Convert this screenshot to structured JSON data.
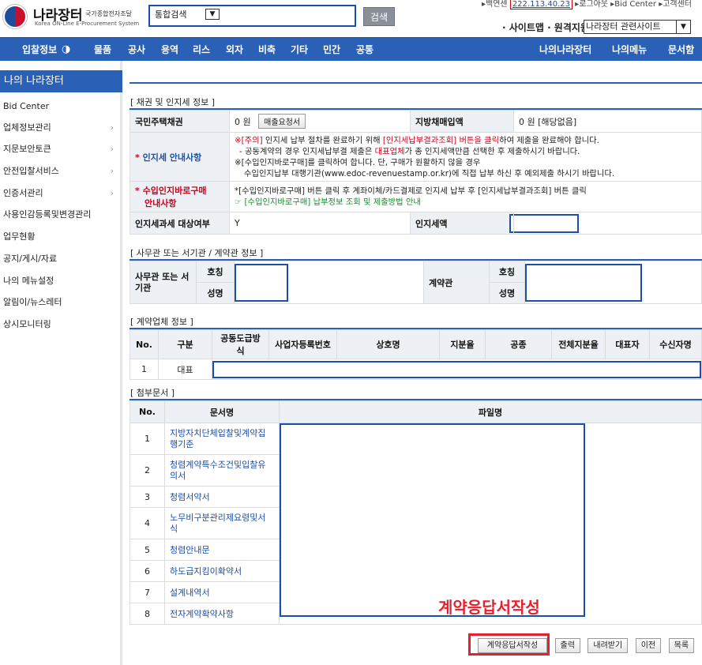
{
  "header": {
    "logo_title": "나라장터",
    "logo_ko": "국가종합전자조달",
    "logo_en": "Korea ON-Line E-Procurement System",
    "search_select": "통합검색",
    "search_button": "검색",
    "top_links_prefix": "▸백연센",
    "top_links_ip": "222.113.40.23",
    "top_links_rest": "▸로그아웃  ▸Bid Center  ▸고객센터",
    "sitemap": "· 사이트맵 · 원격지원",
    "related_select": "나라장터 관련사이트"
  },
  "nav": {
    "items": [
      "입찰정보",
      "물품",
      "공사",
      "용역",
      "리스",
      "외자",
      "비축",
      "기타",
      "민간",
      "공통"
    ],
    "right": [
      "나의나라장터",
      "나의메뉴",
      "문서함"
    ]
  },
  "sidebar": {
    "title": "나의 나라장터",
    "items": [
      "Bid Center",
      "업체정보관리",
      "지문보안토큰",
      "안전입찰서비스",
      "인증서관리",
      "사용인감등록및변경관리",
      "업무현황",
      "공지/게시/자료",
      "나의 메뉴설정",
      "알림이/뉴스레터",
      "상시모니터링"
    ]
  },
  "bond": {
    "section": "[ 채권 및 인지세 정보 ]",
    "housing_bond_label": "국민주택채권",
    "housing_bond_value": "0 원",
    "purchase_request_btn": "매출요청서",
    "municipal_bond_label": "지방채매입액",
    "municipal_bond_value": "0 원  [해당없음]",
    "stamp_guide_label": "인지세 안내사항",
    "stamp_guide_line1_a": "※[주의]",
    "stamp_guide_line1_b": " 인지세 납부 절차를 완료하기 위해 ",
    "stamp_guide_line1_c": "[인지세납부결과조회] 버튼을 클릭",
    "stamp_guide_line1_d": "하여 제출을 완료해야 합니다.",
    "stamp_guide_line2_a": "- 공동계약의 경우 인지세납부결 제출은 ",
    "stamp_guide_line2_b": "대표업체",
    "stamp_guide_line2_c": "가 총 인지세액만큼 선택한 후 제출하시기 바랍니다.",
    "stamp_guide_line3": "※[수입인지바로구매]를 클릭하여 합니다. 단, 구매가 원활하지 않을 경우",
    "stamp_guide_line4": "수입인지납부 대행기관(www.edoc-revenuestamp.or.kr)에 직접 납부 하신 후 예외제출 하시기 바랍니다.",
    "revenue_stamp_label_1": "수입인지바로구매",
    "revenue_stamp_label_2": "안내사항",
    "revenue_stamp_line1": "*[수입인지바로구매] 버튼 클릭 후 계좌이체/카드결제로 인지세 납부 후 [인지세납부결과조회] 버튼 클릭",
    "revenue_stamp_line2": "☞ [수입인지바로구매] 납부정보 조회 및 제출방법 안내",
    "stamp_target_label": "인지세과세 대상여부",
    "stamp_target_value": "Y",
    "stamp_amount_label": "인지세액"
  },
  "office": {
    "section": "[ 사무관 또는 서기관 / 계약관 정보 ]",
    "officer_label": "사무관 또는 서기관",
    "contract_officer_label": "계약관",
    "title_label": "호칭",
    "name_label": "성명"
  },
  "company": {
    "section": "[ 계약업체 정보 ]",
    "headers": [
      "No.",
      "구분",
      "공동도급방식",
      "사업자등록번호",
      "상호명",
      "지분율",
      "공종",
      "전체지분율",
      "대표자",
      "수신자명"
    ],
    "row_no": "1",
    "row_type": "대표"
  },
  "attachments": {
    "section": "[ 첨부문서 ]",
    "headers": [
      "No.",
      "문서명",
      "파일명"
    ],
    "rows": [
      {
        "no": "1",
        "name_1": "지방자치단체입찰및계약집",
        "name_2": "행기준"
      },
      {
        "no": "2",
        "name_1": "청렴계약특수조건및입찰유",
        "name_2": "의서"
      },
      {
        "no": "3",
        "name_1": "청렴서약서",
        "name_2": ""
      },
      {
        "no": "4",
        "name_1": "노무비구분관리제요령및서",
        "name_2": "식"
      },
      {
        "no": "5",
        "name_1": "청렴안내문",
        "name_2": ""
      },
      {
        "no": "6",
        "name_1": "하도급지킴이확약서",
        "name_2": ""
      },
      {
        "no": "7",
        "name_1": "설계내역서",
        "name_2": ""
      },
      {
        "no": "8",
        "name_1": "전자계약확약사항",
        "name_2": ""
      }
    ]
  },
  "footer": {
    "callout": "계약응답서작성",
    "buttons": [
      "계약응답서작성",
      "출력",
      "내려받기",
      "이전",
      "목록"
    ]
  },
  "colors": {
    "primary": "#2b60b7",
    "accent_red": "#e8202e"
  }
}
